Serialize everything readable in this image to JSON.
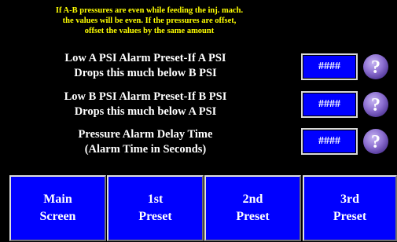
{
  "info_text": "If A-B pressures are even while feeding the inj. mach.\nthe values will be even. If the pressures are offset,\noffset the values by the same amount",
  "settings": [
    {
      "label": "Low A PSI Alarm Preset-If A PSI\nDrops this much below B PSI",
      "value": "####",
      "help_icon": "question-mark-icon"
    },
    {
      "label": "Low B PSI Alarm Preset-If B PSI\nDrops this much below A PSI",
      "value": "####",
      "help_icon": "question-mark-icon"
    },
    {
      "label": "Pressure Alarm Delay Time\n(Alarm Time in Seconds)",
      "value": "####",
      "help_icon": "question-mark-icon"
    }
  ],
  "nav": [
    {
      "label": "Main\nScreen"
    },
    {
      "label": "1st\nPreset"
    },
    {
      "label": "2nd\nPreset"
    },
    {
      "label": "3rd\nPreset"
    }
  ],
  "colors": {
    "background": "#000000",
    "info_text": "#ffff00",
    "button_blue": "#0000ff",
    "help_purple": "#8c6fd0"
  }
}
